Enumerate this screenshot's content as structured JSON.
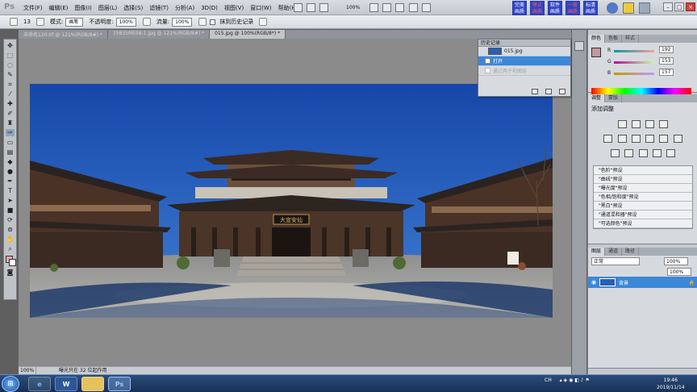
{
  "app": {
    "logo": "Ps"
  },
  "menubar": {
    "items": [
      "文件(F)",
      "编辑(E)",
      "图像(I)",
      "图层(L)",
      "选择(S)",
      "滤镜(T)",
      "分析(A)",
      "3D(D)",
      "视图(V)",
      "窗口(W)",
      "帮助(H)"
    ],
    "zoom": "100%",
    "oem_buttons": [
      "完美\n画质",
      "停止\n画质",
      "软件\n画质",
      "一般\n画质",
      "标清\n画质"
    ]
  },
  "options": {
    "brush_size": "13",
    "mode_label": "模式:",
    "mode_value": "画笔",
    "opacity_label": "不透明度:",
    "opacity_value": "100%",
    "flow_label": "流量:",
    "flow_value": "100%",
    "erase_history_label": "抹到历史记录"
  },
  "doc_tabs": [
    {
      "label": "未命名120.tif @ 121%(RGB/8#) *",
      "active": false
    },
    {
      "label": "15835M558-1.jpg @ 121%(RGB/8#) *",
      "active": false
    },
    {
      "label": "015.jpg @ 100%(RGB/8*) *",
      "active": true
    }
  ],
  "status": {
    "zoom": "100%",
    "doc_info": "曝光只在 32 位起作用"
  },
  "history": {
    "tab": "历史记录",
    "items": [
      {
        "label": "015.jpg",
        "type": "snapshot"
      },
      {
        "label": "打开",
        "type": "selected"
      },
      {
        "label": "通过两子和图层",
        "type": "ghost"
      }
    ]
  },
  "color_panel": {
    "tabs": [
      "颜色",
      "色板",
      "样式"
    ],
    "r": "192",
    "g": "153",
    "b": "157",
    "r_label": "R",
    "g_label": "G",
    "b_label": "B",
    "fg_color": "#c0999d"
  },
  "adjust_panel": {
    "tabs": [
      "调整",
      "蒙版"
    ],
    "title": "添加调整",
    "presets": [
      "\"色阶\"预设",
      "\"曲线\"预设",
      "\"曝光度\"预设",
      "\"色相/饱和度\"预设",
      "\"黑白\"预设",
      "\"通道混和器\"预设",
      "\"可选颜色\"预设"
    ]
  },
  "layers_panel": {
    "tabs": [
      "图层",
      "通道",
      "路径"
    ],
    "blend_mode": "正常",
    "opacity_value": "100%",
    "fill_value": "100%",
    "layer_name": "背景"
  },
  "sign_text": "大宣安仙",
  "taskbar": {
    "buttons": [
      "e",
      "W",
      "",
      "Ps"
    ],
    "tray_lang": "CH",
    "time": "19:46",
    "date": "2019/11/14"
  }
}
